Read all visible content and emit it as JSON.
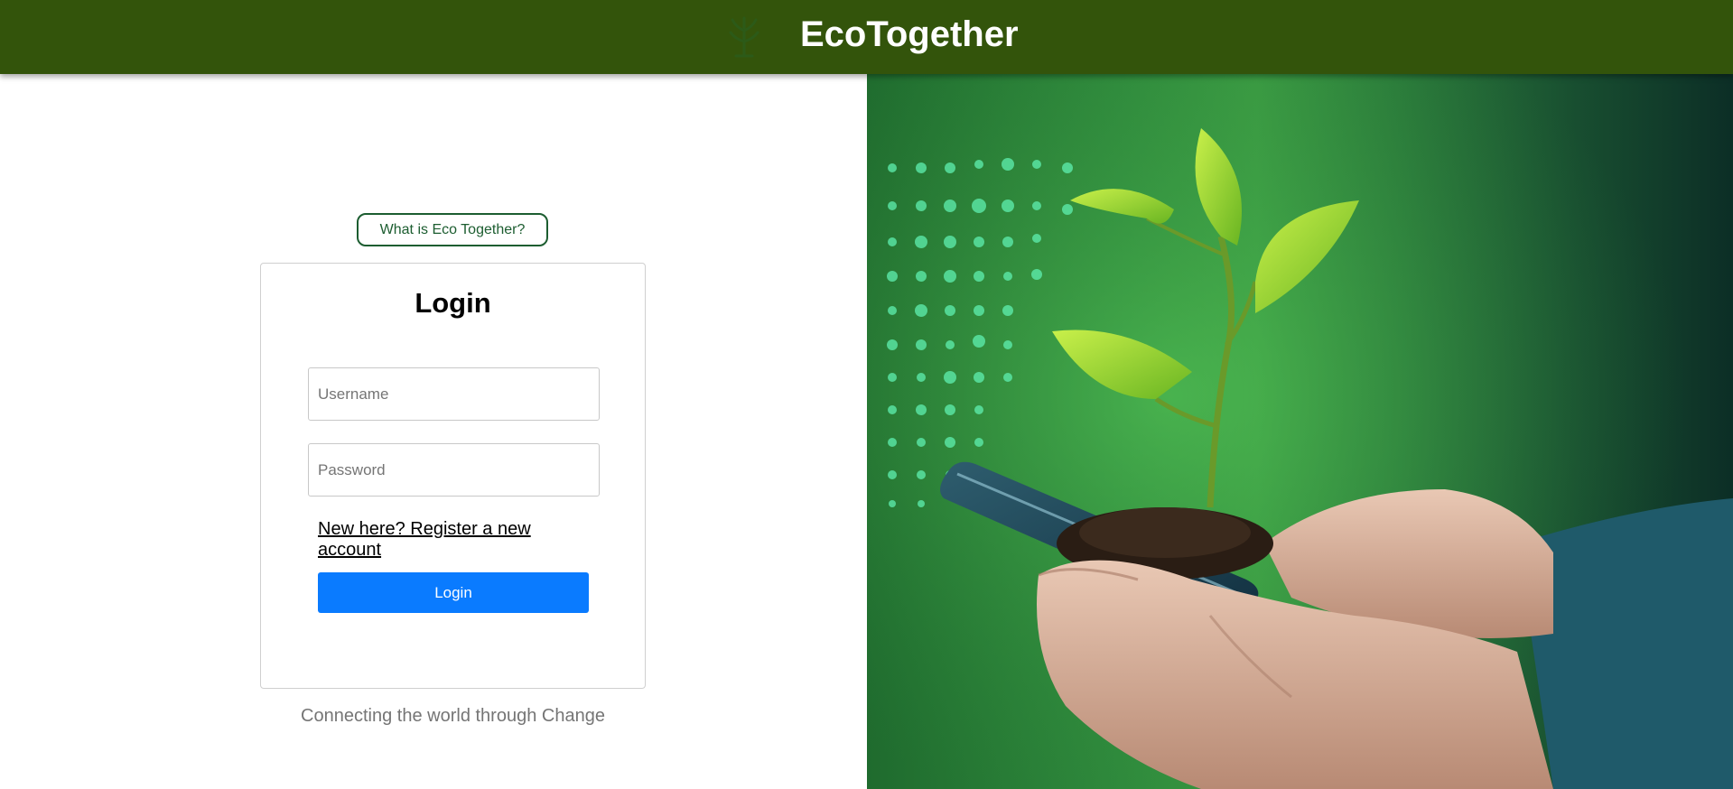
{
  "header": {
    "title": "EcoTogether",
    "logo_icon": "plant-logo-icon",
    "background_color": "#33540b"
  },
  "about_button": {
    "label": "What is Eco Together?",
    "accent_color": "#1c5d30"
  },
  "login_card": {
    "title": "Login",
    "username": {
      "placeholder": "Username",
      "value": ""
    },
    "password": {
      "placeholder": "Password",
      "value": ""
    },
    "register_link": "New here? Register a new account",
    "submit_label": "Login",
    "submit_color": "#0a7bff"
  },
  "tagline": "Connecting the world through Change",
  "hero": {
    "subject": "hands holding smartphone with sprouting plant in soil",
    "dominant_color": "#2f8a3c"
  }
}
